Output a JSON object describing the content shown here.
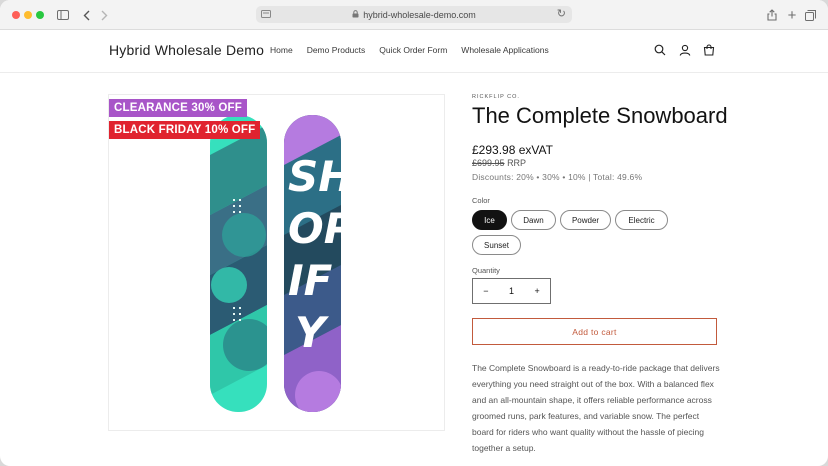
{
  "browser": {
    "url": "hybrid-wholesale-demo.com"
  },
  "site": {
    "brand": "Hybrid Wholesale Demo",
    "nav": [
      "Home",
      "Demo Products",
      "Quick Order Form",
      "Wholesale Applications"
    ]
  },
  "product": {
    "badges": [
      "CLEARANCE 30% OFF",
      "BLACK FRIDAY 10% OFF"
    ],
    "vendor": "RICKFLIP CO.",
    "title": "The Complete Snowboard",
    "price": "£293.98 exVAT",
    "rrp_strike": "£699.95",
    "rrp_label": "RRP",
    "discounts": "Discounts: 20% • 30% • 10% | Total: 49.6%",
    "color_label": "Color",
    "colors": [
      "Ice",
      "Dawn",
      "Powder",
      "Electric",
      "Sunset"
    ],
    "selected_color": "Ice",
    "quantity_label": "Quantity",
    "quantity": "1",
    "qty_minus": "−",
    "qty_plus": "+",
    "add_to_cart": "Add to cart",
    "description": "The Complete Snowboard is a ready-to-ride package that delivers everything you need straight out of the box. With a balanced flex and an all-mountain shape, it offers reliable performance across groomed runs, park features, and variable snow. The perfect board for riders who want quality without the hassle of piecing together a setup.",
    "board_graphic_text": "SHOPIFY"
  },
  "colors": {
    "accent": "#c25a3c",
    "clearance_badge": "#a855c8",
    "blackfriday_badge": "#e0232f",
    "board_teal": "#3fe0b8",
    "board_dark": "#234a5e",
    "board_purple": "#b57be0"
  }
}
